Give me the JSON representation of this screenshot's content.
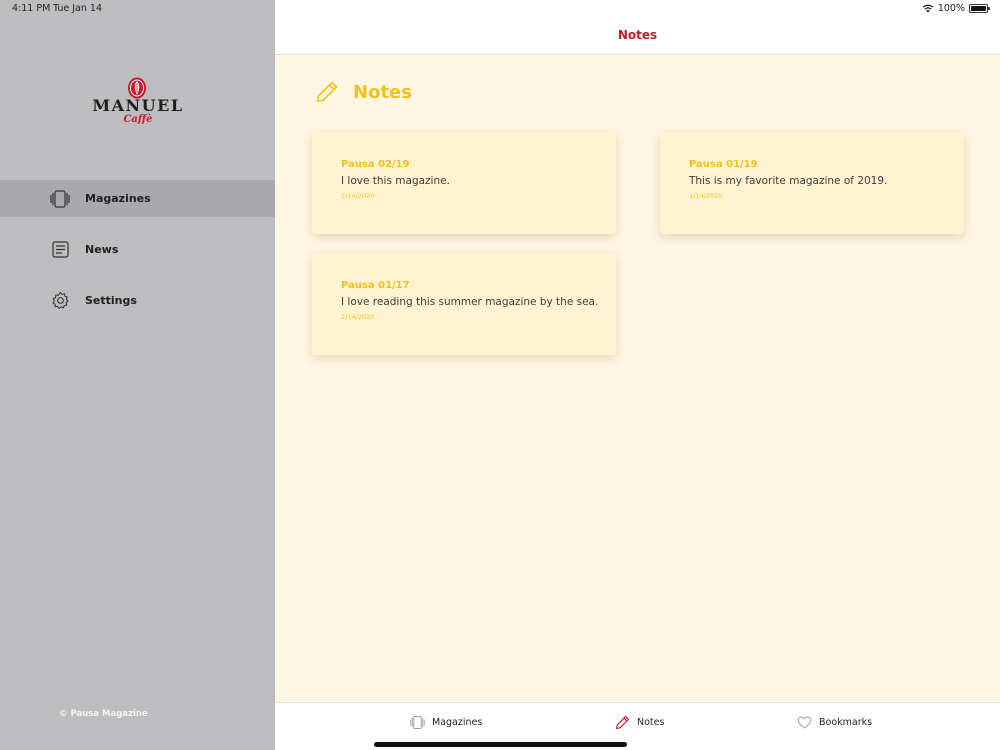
{
  "status_bar": {
    "time": "4:11 PM",
    "date": "Tue Jan 14",
    "battery": "100%",
    "icons": [
      "wifi-icon",
      "battery-icon"
    ]
  },
  "sidebar": {
    "logo": {
      "name": "MANUEL",
      "sub": "Caffè"
    },
    "items": [
      {
        "label": "Magazines",
        "icon": "magazines-icon",
        "active": true
      },
      {
        "label": "News",
        "icon": "news-icon",
        "active": false
      },
      {
        "label": "Settings",
        "icon": "gear-icon",
        "active": false
      }
    ],
    "copyright": "© Pausa Magazine"
  },
  "header": {
    "title": "Notes"
  },
  "page": {
    "title": "Notes",
    "icon": "pencil-icon"
  },
  "notes": [
    {
      "title": "Pausa 02/19",
      "text": "I love this magazine.",
      "date": "1/14/2020"
    },
    {
      "title": "Pausa 01/19",
      "text": "This is my favorite magazine of 2019.",
      "date": "1/14/2020"
    },
    {
      "title": "Pausa 01/17",
      "text": "I love reading this summer magazine by the sea.",
      "date": "1/14/2020"
    }
  ],
  "tabs": [
    {
      "label": "Magazines",
      "icon": "magazines-icon",
      "active": false
    },
    {
      "label": "Notes",
      "icon": "pencil-icon",
      "active": true
    },
    {
      "label": "Bookmarks",
      "icon": "heart-icon",
      "active": false
    }
  ],
  "colors": {
    "accent_red": "#c41a2b",
    "accent_yellow": "#f2c21b",
    "sidebar_bg": "#bdbcbf",
    "content_bg": "#fff7e3"
  }
}
